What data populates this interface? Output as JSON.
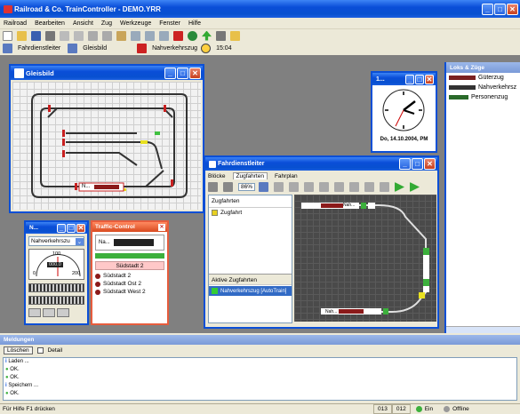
{
  "app": {
    "title": "Railroad & Co. TrainController - DEMO.YRR"
  },
  "menu": [
    "Railroad",
    "Bearbeiten",
    "Ansicht",
    "Zug",
    "Werkzeuge",
    "Fenster",
    "Hilfe"
  ],
  "toolbar2": {
    "dispatcher": "Fahrdienstleiter",
    "switchboard": "Gleisbild",
    "train": "Nahverkehrszug",
    "time": "15:04"
  },
  "gleisbild": {
    "title": "Gleisbild",
    "train_label": "N..."
  },
  "clock": {
    "title": "1...",
    "date": "Do, 14.10.2004, PM"
  },
  "trains": {
    "title": "Loks & Züge",
    "items": [
      "Güterzug",
      "Nahverkehrsz",
      "Personenzug"
    ]
  },
  "dispatcher": {
    "title": "Fahrdienstleiter",
    "tabs": [
      "Blöcke",
      "Zugfahrten",
      "Fahrplan"
    ],
    "zoom": "86%",
    "schedules_header": "Zugfahrten",
    "schedules": [
      "Zugfahrt"
    ],
    "active_header": "Aktive Zugfahrten",
    "active": [
      "Nahverkehrszug [AutoTrain]"
    ],
    "label_top": "Nah...",
    "label_bottom": "Nah..."
  },
  "cab": {
    "title": "N...",
    "selected": "Nahverkehrszu",
    "speed_max": "200",
    "speed_mid": "100",
    "speed_zero": "0",
    "speed_value": "000.0"
  },
  "traffic": {
    "title": "Traffic-Control",
    "train": "Na...",
    "current": "Südstadt 2",
    "rows": [
      "Südstadt 2",
      "Südstadt Ost 2",
      "Südstadt West 2"
    ]
  },
  "messages": {
    "title": "Meldungen",
    "clear": "Löschen",
    "detail": "Detail",
    "lines": [
      "Laden ...",
      "OK.",
      "OK.",
      "Speichern ...",
      "OK."
    ]
  },
  "status": {
    "help": "Für Hilfe F1 drücken",
    "c1": "013",
    "c2": "012",
    "on": "Ein",
    "offline": "Offline"
  },
  "colors": {
    "title_blue": "#0a4ed8",
    "green": "#3cb03c",
    "red": "#c8401d"
  }
}
